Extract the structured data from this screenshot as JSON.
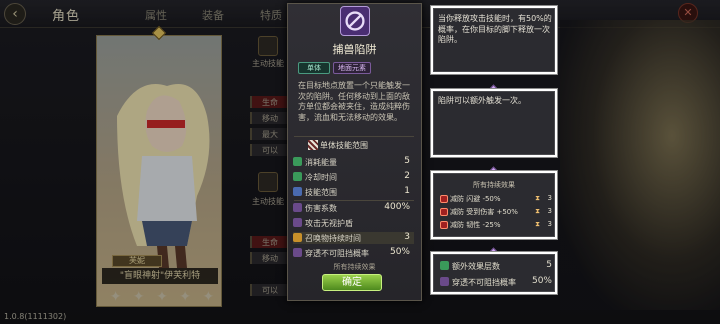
{
  "header": {
    "title": "角色",
    "tabs": [
      "属性",
      "装备",
      "特质"
    ]
  },
  "hero": {
    "name": "芙妮",
    "title": "\"盲眼神射\"伊芙利特",
    "star_count": 5
  },
  "version": "1.0.8(1111302)",
  "bg_skill_list": {
    "labels": [
      "主动技能",
      "生命",
      "移动",
      "最大",
      "可以",
      "主动技能",
      "生命",
      "移动",
      "可以"
    ]
  },
  "popup": {
    "skill_name": "捕兽陷阱",
    "tags": [
      "单体",
      "地面元素"
    ],
    "description": "在目标地点放置一个只能触发一次的陷阱。任何移动到上面的敌方单位都会被夹住，造成纯粹伤害，流血和无法移动的效果。",
    "range_label": "单体技能范围",
    "stats": [
      {
        "label": "消耗能量",
        "value": "5",
        "color": "#3a9a5a"
      },
      {
        "label": "冷却时间",
        "value": "2",
        "color": "#3a9a5a"
      },
      {
        "label": "技能范围",
        "value": "1",
        "color": "#4a6ab0"
      },
      {
        "label": "伤害系数",
        "value": "400%",
        "color": "#6a4a8a"
      },
      {
        "label": "攻击无视护盾",
        "value": "",
        "color": "#6a4a8a"
      },
      {
        "label": "召唤物持续时间",
        "value": "3",
        "color": "#c8902a"
      },
      {
        "label": "穿透不可阻挡概率",
        "value": "50%",
        "color": "#6a4a8a"
      }
    ],
    "footer_label": "所有持续效果",
    "confirm_label": "确定"
  },
  "tooltips": {
    "top": "当你释放攻击技能时，有50%的概率，在你目标的脚下释放一次陷阱。",
    "middle": "陷阱可以额外触发一次。",
    "effects_title": "所有持续效果",
    "effects": [
      {
        "label": "减防  闪避 -50%",
        "turns": "3"
      },
      {
        "label": "减防  受到伤害 +50%",
        "turns": "3"
      },
      {
        "label": "减防  韧性 -25%",
        "turns": "3"
      }
    ],
    "extra": [
      {
        "label": "额外效果层数",
        "value": "5",
        "color": "#3a9a5a"
      },
      {
        "label": "穿透不可阻挡概率",
        "value": "50%",
        "color": "#6a4a8a"
      }
    ]
  },
  "colors": {
    "accent_green": "#7ab83a",
    "skill_purple": "#4a2e72",
    "debuff_red": "#a02020"
  }
}
